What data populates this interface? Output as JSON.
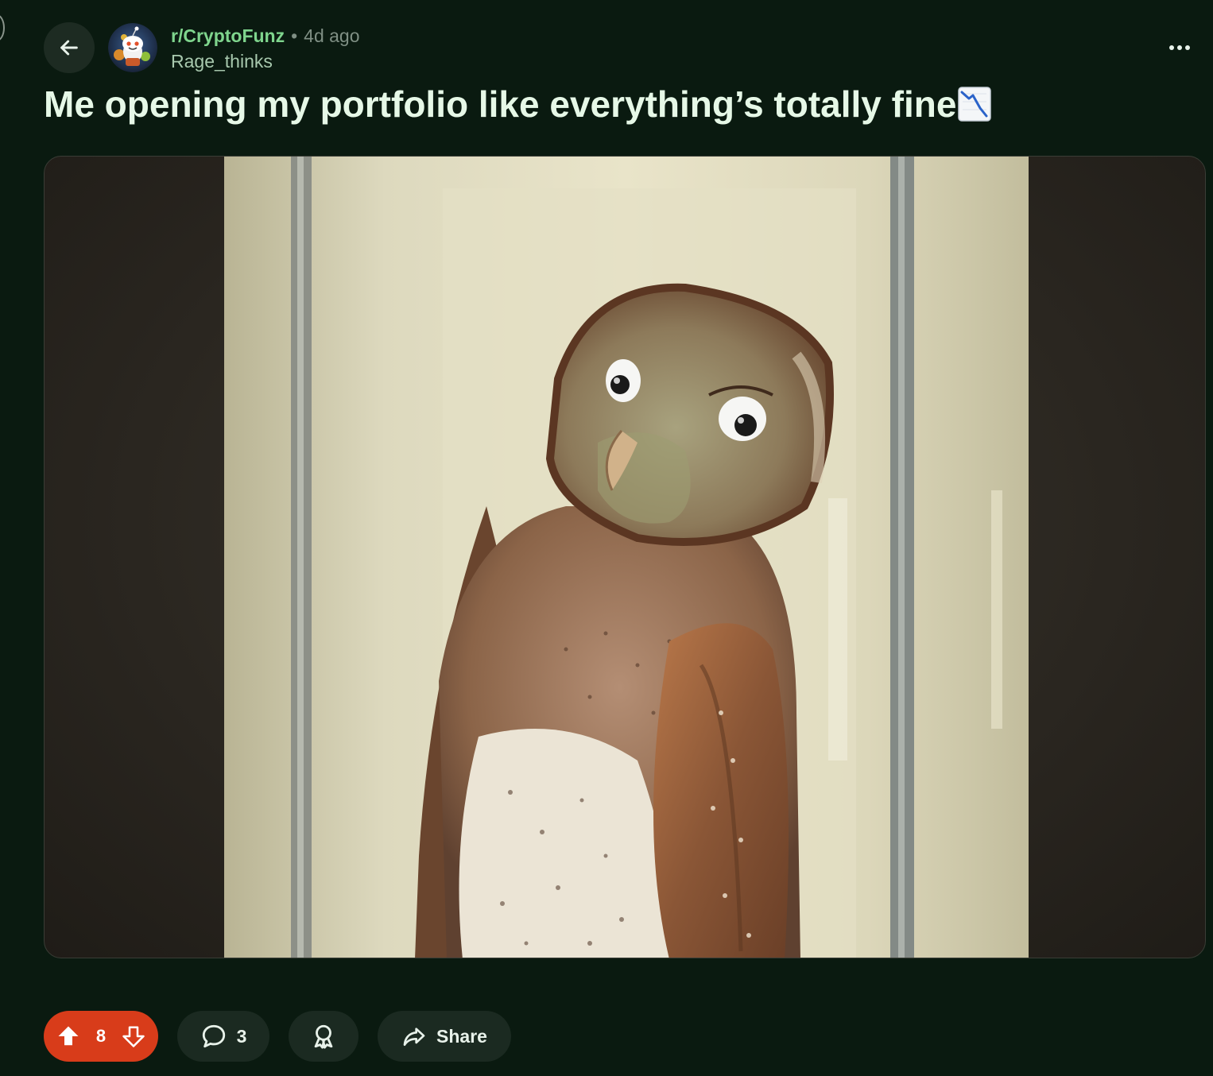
{
  "post": {
    "subreddit": "r/CryptoFunz",
    "separator": "•",
    "time_ago": "4d ago",
    "author": "Rage_thinks",
    "title": "Me opening my portfolio like everything’s totally fine",
    "title_emoji": "chart-decreasing-emoji"
  },
  "icons": {
    "back": "left-arrow-icon",
    "more": "ellipsis-icon",
    "upvote": "upvote-arrow-icon",
    "downvote": "downvote-arrow-icon",
    "comment": "speech-bubble-icon",
    "award": "award-ribbon-icon",
    "share": "share-arrow-icon"
  },
  "actions": {
    "vote_count": "8",
    "comment_count": "3",
    "share_label": "Share"
  },
  "colors": {
    "background": "#0a1a10",
    "subreddit": "#7fd58d",
    "author": "#a8c9ae",
    "title": "#e6f8e7",
    "upvoted": "#d83c1a",
    "pill": "#1b2a21"
  }
}
